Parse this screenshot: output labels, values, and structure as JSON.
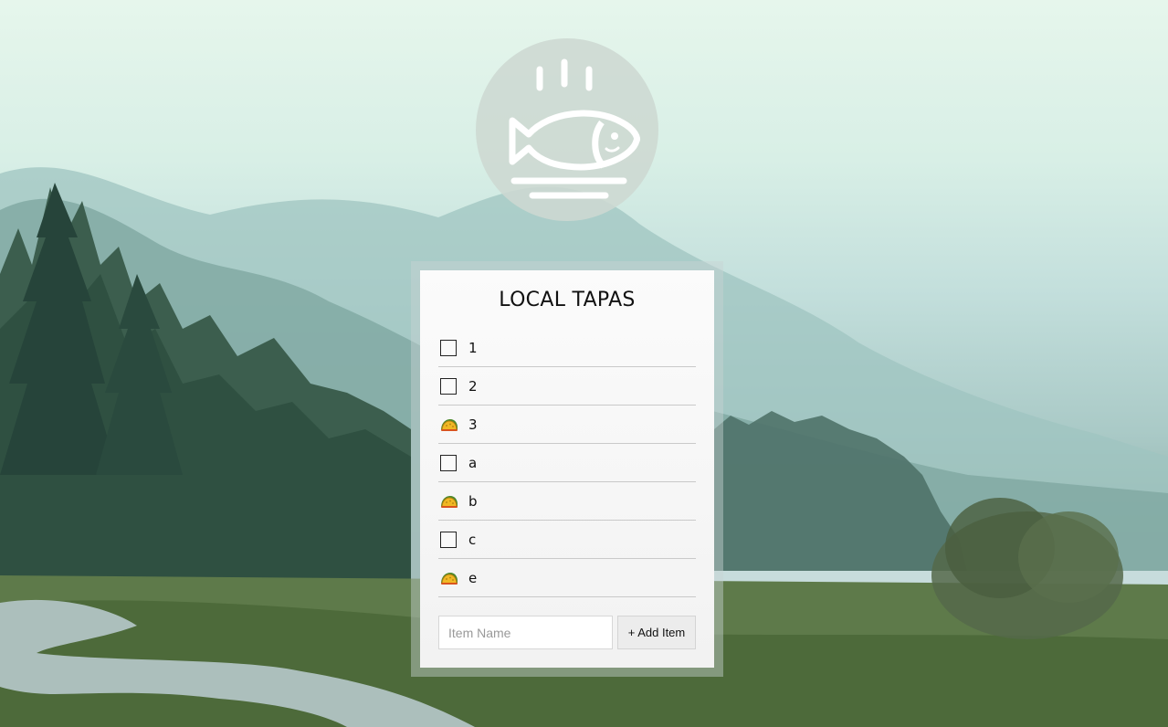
{
  "app": {
    "title": "LOCAL TAPAS",
    "logo_icon": "steaming-fish-plate-icon"
  },
  "items": [
    {
      "label": "1",
      "checked": false,
      "icon": "checkbox-empty"
    },
    {
      "label": "2",
      "checked": false,
      "icon": "checkbox-empty"
    },
    {
      "label": "3",
      "checked": true,
      "icon": "taco-icon"
    },
    {
      "label": "a",
      "checked": false,
      "icon": "checkbox-empty"
    },
    {
      "label": "b",
      "checked": true,
      "icon": "taco-icon"
    },
    {
      "label": "c",
      "checked": false,
      "icon": "checkbox-empty"
    },
    {
      "label": "e",
      "checked": true,
      "icon": "taco-icon"
    }
  ],
  "add_form": {
    "placeholder": "Item Name",
    "value": "",
    "button_label": "+ Add Item"
  },
  "colors": {
    "card_background": "#f5f5f5",
    "logo_circle": "#cdd8d2",
    "divider": "#c9c9c9",
    "taco_shell": "#f0b824",
    "taco_filling": "#4c8a2b"
  }
}
